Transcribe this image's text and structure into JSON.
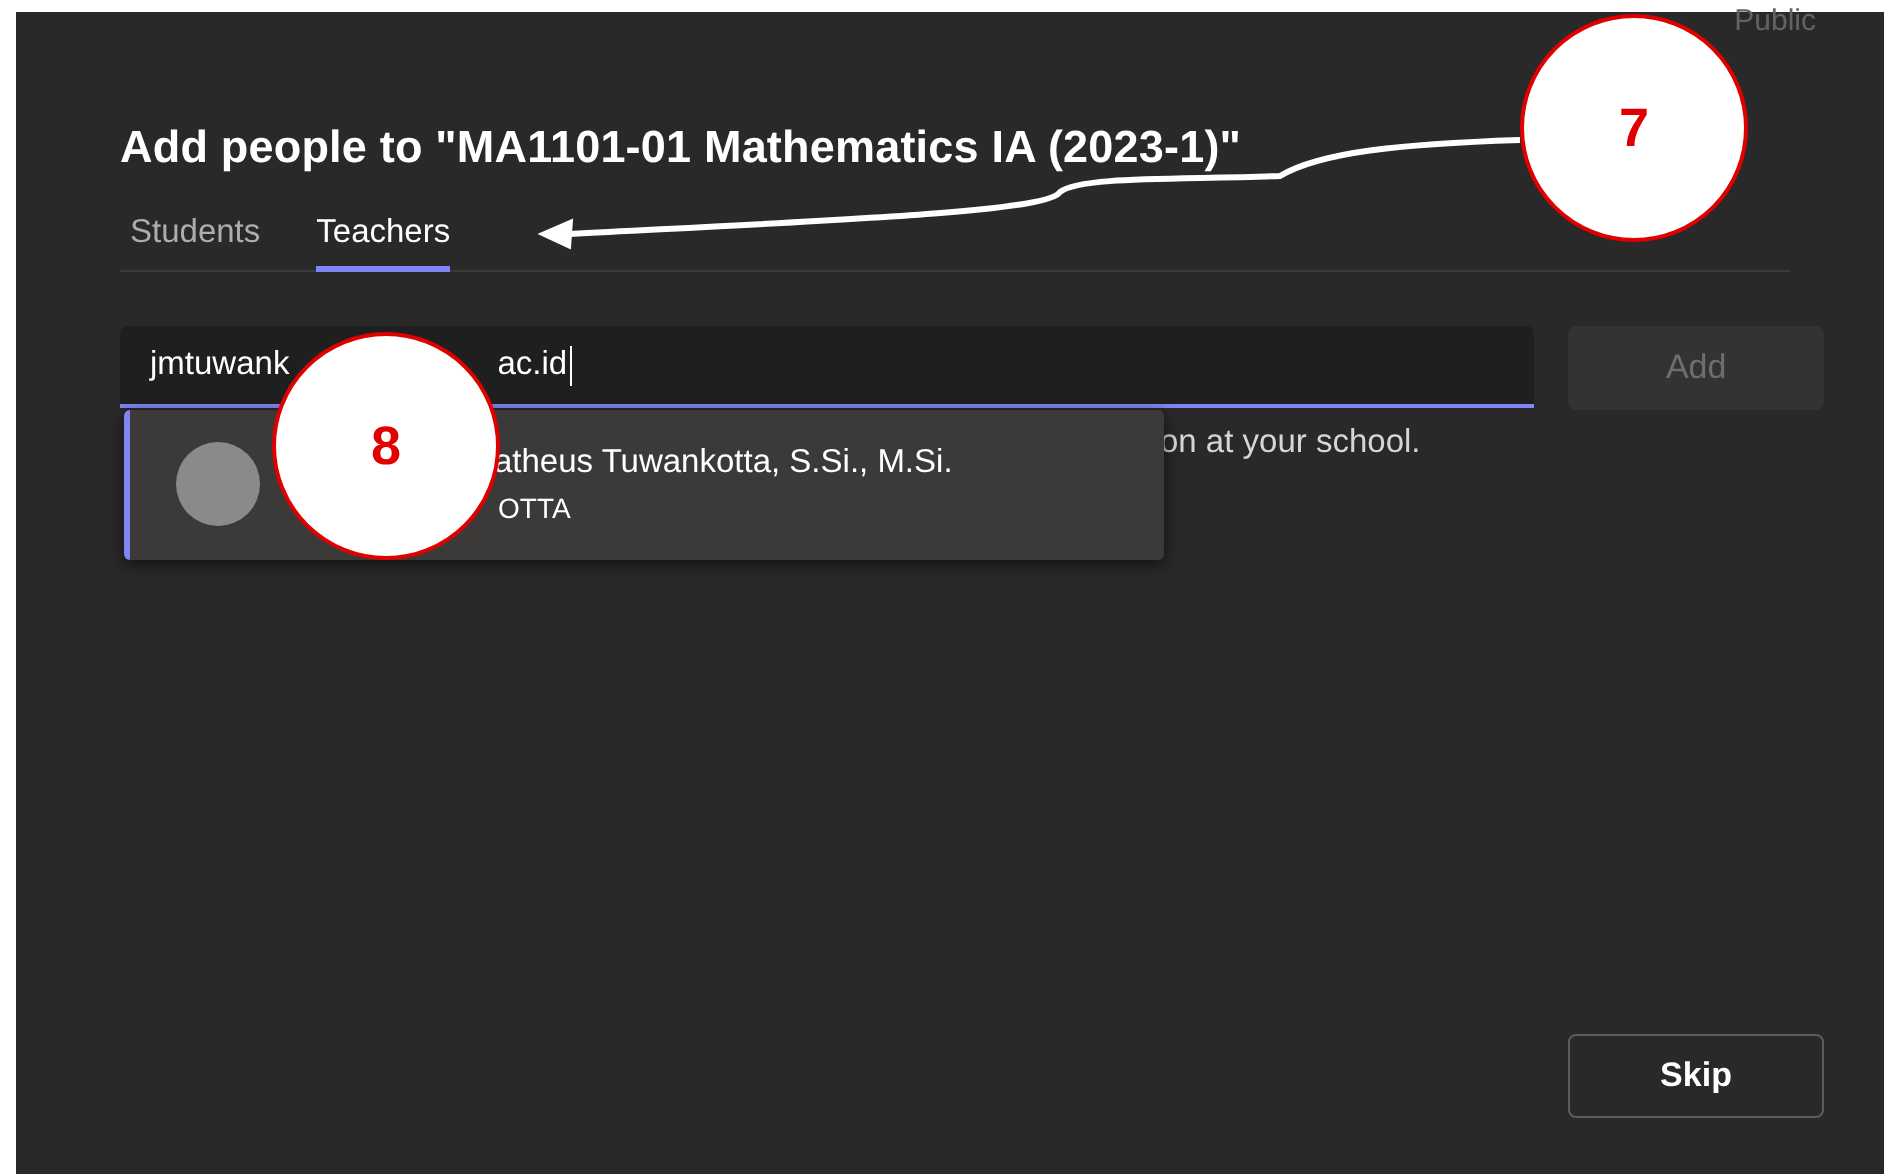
{
  "background": {
    "fragment": "Public"
  },
  "dialog": {
    "title": "Add people to \"MA1101-01 Mathematics IA (2023-1)\"",
    "tabs": [
      {
        "label": "Students",
        "selected": false
      },
      {
        "label": "Teachers",
        "selected": true
      }
    ],
    "search": {
      "value_start": "jmtuwank",
      "value_end": "ac.id"
    },
    "add_button": {
      "label": "Add",
      "disabled": true
    },
    "hint": "on at your school.",
    "suggestion": {
      "name": "atheus Tuwankotta, S.Si., M.Si.",
      "detail": "OTTA"
    },
    "skip_button": {
      "label": "Skip"
    }
  },
  "callouts": [
    {
      "label": "7"
    },
    {
      "label": "8"
    }
  ]
}
